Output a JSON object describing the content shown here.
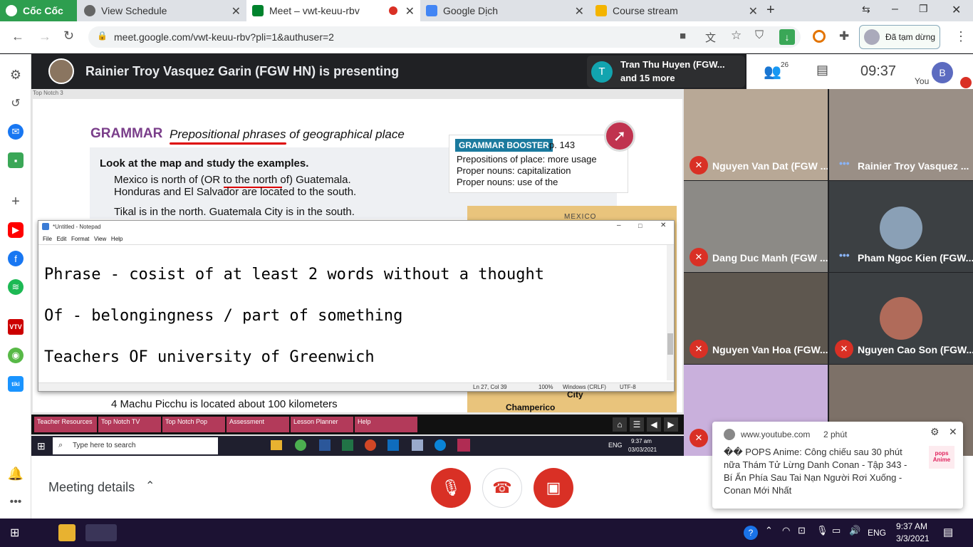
{
  "browser": {
    "tabs": [
      {
        "title": "Cốc Cốc"
      },
      {
        "title": "View Schedule"
      },
      {
        "title": "Meet – vwt-keuu-rbv"
      },
      {
        "title": "Google Dịch"
      },
      {
        "title": "Course stream"
      }
    ],
    "url": "meet.google.com/vwt-keuu-rbv?pli=1&authuser=2",
    "profile_status": "Đã tạm dừng"
  },
  "meet": {
    "presenting": "Rainier Troy Vasquez Garin (FGW HN) is presenting",
    "active_speaker_initial": "T",
    "active_speaker": "Tran Thu Huyen (FGW...",
    "active_speaker_more": "and 15 more",
    "participant_count": "26",
    "time": "09:37",
    "self_label": "You",
    "self_initial": "B",
    "meeting_details": "Meeting details",
    "participants": [
      {
        "name": "Nguyen Van Dat (FGW ...",
        "muted": true
      },
      {
        "name": "Rainier Troy Vasquez ...",
        "muted": false
      },
      {
        "name": "Dang Duc Manh (FGW ...",
        "muted": true
      },
      {
        "name": "Pham Ngoc Kien (FGW...",
        "muted": false
      },
      {
        "name": "Nguyen Van Hoa (FGW...",
        "muted": true
      },
      {
        "name": "Nguyen Cao Son (FGW...",
        "muted": true
      }
    ]
  },
  "slide": {
    "window_title": "Top Notch 3",
    "heading": "GRAMMAR",
    "subheading": "Prepositional phrases of geographical place",
    "instruction": "Look at the map and study the examples.",
    "ex1": "Mexico is north of (OR to the north of) Guatemala.",
    "ex2": "Honduras and El Salvador are located to the south.",
    "ex3": "Tikal is in the north. Guatemala City is in the south.",
    "booster_title": "GRAMMAR BOOSTER",
    "booster_page": "p. 143",
    "booster_items": [
      "Prepositions of place: more usage",
      "Proper nouns: capitalization",
      "Proper nouns: use of the"
    ],
    "map_label_1": "MEXICO",
    "map_label_2": "City",
    "map_label_3": "Champerico",
    "ex4": "4  Machu Picchu is located about 100 kilometers",
    "lesson_buttons": [
      "Teacher Resources",
      "Top Notch TV",
      "Top Notch Pop",
      "Assessment",
      "Lesson Planner",
      "Help"
    ]
  },
  "notepad": {
    "title": "*Untitled - Notepad",
    "menu": [
      "File",
      "Edit",
      "Format",
      "View",
      "Help"
    ],
    "lines": [
      "Phrase - cosist of at least 2 words without a thought",
      "Of - belongingness / part of something",
      "Teachers OF university of Greenwich"
    ],
    "status": [
      "Ln 27, Col 39",
      "100%",
      "Windows (CRLF)",
      "UTF-8"
    ]
  },
  "inner_taskbar": {
    "search_placeholder": "Type here to search",
    "lang": "ENG",
    "time": "9:37 am",
    "date": "03/03/2021"
  },
  "toast": {
    "source": "www.youtube.com",
    "age": "2 phút",
    "text": "�� POPS Anime: Công chiếu sau 30 phút nữa Thám Tử Lừng Danh Conan - Tập 343 - Bí Ẩn Phía Sau Tai Nạn Người Rơi Xuống - Conan Mới Nhất",
    "thumb": "pops Anime"
  },
  "os_taskbar": {
    "lang": "ENG",
    "time": "9:37 AM",
    "date": "3/3/2021"
  },
  "colors": {
    "accent_red": "#d93025",
    "meet_bg": "#202124",
    "grammar_purple": "#7a3e8a",
    "link_blue": "#1a73e8"
  }
}
